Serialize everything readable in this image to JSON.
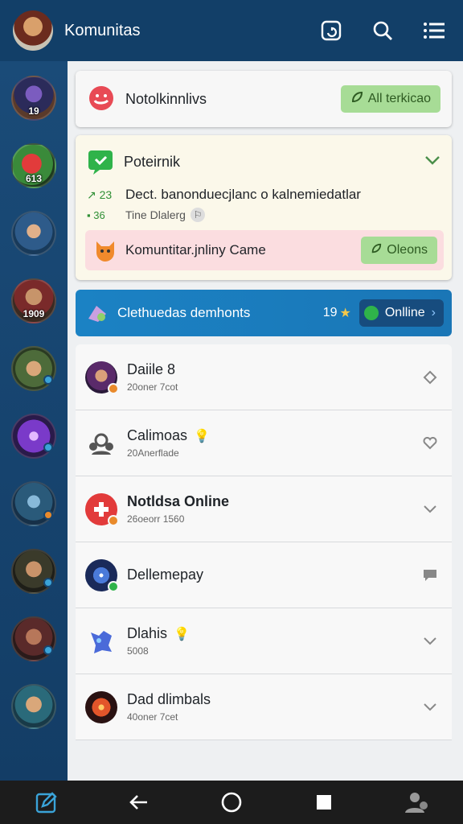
{
  "topbar": {
    "title": "Komunitas",
    "icons": [
      "profile-avatar",
      "share-icon",
      "search-icon",
      "menu-icon"
    ]
  },
  "sidebar": {
    "avatars": [
      {
        "level": "19",
        "dot": ""
      },
      {
        "level": "613",
        "dot": ""
      },
      {
        "level": "",
        "dot": ""
      },
      {
        "level": "1909",
        "dot": ""
      },
      {
        "level": "",
        "dot": "#3aa3d8"
      },
      {
        "level": "",
        "dot": "#3aa3d8"
      },
      {
        "level": "",
        "dot": "#e98a2b"
      },
      {
        "level": "",
        "dot": "#3aa3d8"
      },
      {
        "level": "",
        "dot": "#3aa3d8"
      },
      {
        "level": "",
        "dot": ""
      }
    ]
  },
  "notification": {
    "text": "Notolkinnlivs",
    "button": "All terkicao"
  },
  "post": {
    "title": "Poteirnik",
    "line_stat": "23",
    "line_text": "Dect. banonduecjlanc o kalnemiedatlar",
    "sub_stat": "36",
    "sub_text": "Tine Dlalerg",
    "promo_text": "Komuntitar.jnliny Came",
    "promo_button": "Oleons"
  },
  "banner": {
    "text": "Clethuedas demhonts",
    "count": "19",
    "online_label": "Onlline"
  },
  "rows": [
    {
      "name": "Daiile 8",
      "sub": "20oner 7cot",
      "dot": "#e98a2b",
      "badge": ""
    },
    {
      "name": "Calimoas",
      "sub": "20Anerflade",
      "dot": "",
      "badge": "💡"
    },
    {
      "name": "Notldsa Online",
      "sub": "26oeorr 1560",
      "dot": "#e98a2b",
      "badge": ""
    },
    {
      "name": "Dellemepay",
      "sub": "",
      "dot": "#2fb34a",
      "badge": ""
    },
    {
      "name": "Dlahis",
      "sub": "5008",
      "dot": "",
      "badge": "💡"
    },
    {
      "name": "Dad dlimbals",
      "sub": "40oner 7cet",
      "dot": "",
      "badge": ""
    }
  ],
  "colors": {
    "topbar": "#123f68",
    "sidebar": "#1a4b78",
    "accent_green": "#a7dc96",
    "banner_blue": "#1b82c4"
  }
}
